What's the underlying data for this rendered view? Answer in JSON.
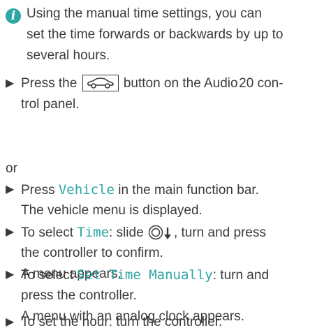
{
  "note": {
    "icon": "info-icon",
    "line1": "Using the manual time settings, you can",
    "line2": "set the time forwards or backwards by up to",
    "line3": "several hours."
  },
  "steps": [
    {
      "line1_a": "Press the",
      "button_icon": "car-icon",
      "line1_b": "button on the Audio 20 con-",
      "line2": "trol panel."
    }
  ],
  "or_text": "or",
  "step_vehicle": {
    "line1_a": "Press",
    "hl": "Vehicle",
    "line1_b": "in the main function bar.",
    "line2": "The vehicle menu is displayed."
  },
  "step_time": {
    "line1_a": "To select",
    "hl": "Time",
    "line1_b": ": slide",
    "controller_icon": "controller-slide-down-icon",
    "line1_c": ", turn and press",
    "line2": "the controller to confirm.",
    "line3": "A menu appears."
  },
  "step_manual": {
    "line1_a": "To select",
    "hl": "Set Time Manually",
    "line1_b": ": turn and",
    "line2": "press the controller.",
    "line3": "A menu with an analog clock appears."
  },
  "step_hour": {
    "line1": "To set the hour: turn the controller."
  },
  "colors": {
    "text": "#3a3a3a",
    "accent": "#2da6a4"
  }
}
